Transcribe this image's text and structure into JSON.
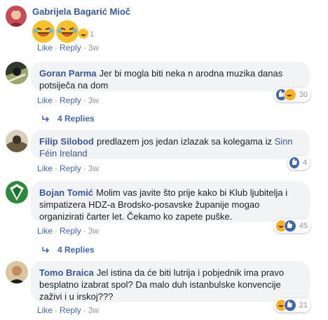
{
  "comments": [
    {
      "author": "Gabrijela Bagarić Mioč",
      "emoji_reaction_count": "1",
      "actions": {
        "like": "Like",
        "reply": "Reply",
        "time": "3w"
      }
    },
    {
      "author": "Goran Parma",
      "text": "Jer bi mogla biti neka n arodna muzika danas potsiječa na dom",
      "reaction_count": "30",
      "actions": {
        "like": "Like",
        "reply": "Reply",
        "time": "3w"
      },
      "replies_label": "4 Replies"
    },
    {
      "author": "Filip Silobod",
      "text": "predlazem jos jedan izlazak sa kolegama iz",
      "page_link": "Sinn Féin Ireland",
      "reaction_count": "4",
      "actions": {
        "like": "Like",
        "reply": "Reply",
        "time": "3w"
      }
    },
    {
      "author": "Bojan Tomić",
      "text": "Molim vas javite što prije kako bi Klub ljubitelja i simpatizera HDZ-a Brodsko-posavske županije mogao organizirati čarter let. Čekamo ko zapete puške.",
      "reaction_count": "45",
      "actions": {
        "like": "Like",
        "reply": "Reply",
        "time": "3w"
      },
      "replies_label": "4 Replies"
    },
    {
      "author": "Tomo Braica",
      "text": "Jel istina da će biti lutrija i pobjednik ima pravo besplatno izabrat spol? Da malo duh istanbulske konvencije zaživi i u irskoj???",
      "reaction_count": "21",
      "actions": {
        "like": "Like",
        "reply": "Reply",
        "time": "3w"
      }
    }
  ],
  "separator": "·",
  "colors": {
    "link": "#4267b2",
    "name": "#385898",
    "bubble": "#f2f3f5",
    "meta": "#90949c",
    "like": "#4267b2",
    "haha": "#f7b125"
  }
}
